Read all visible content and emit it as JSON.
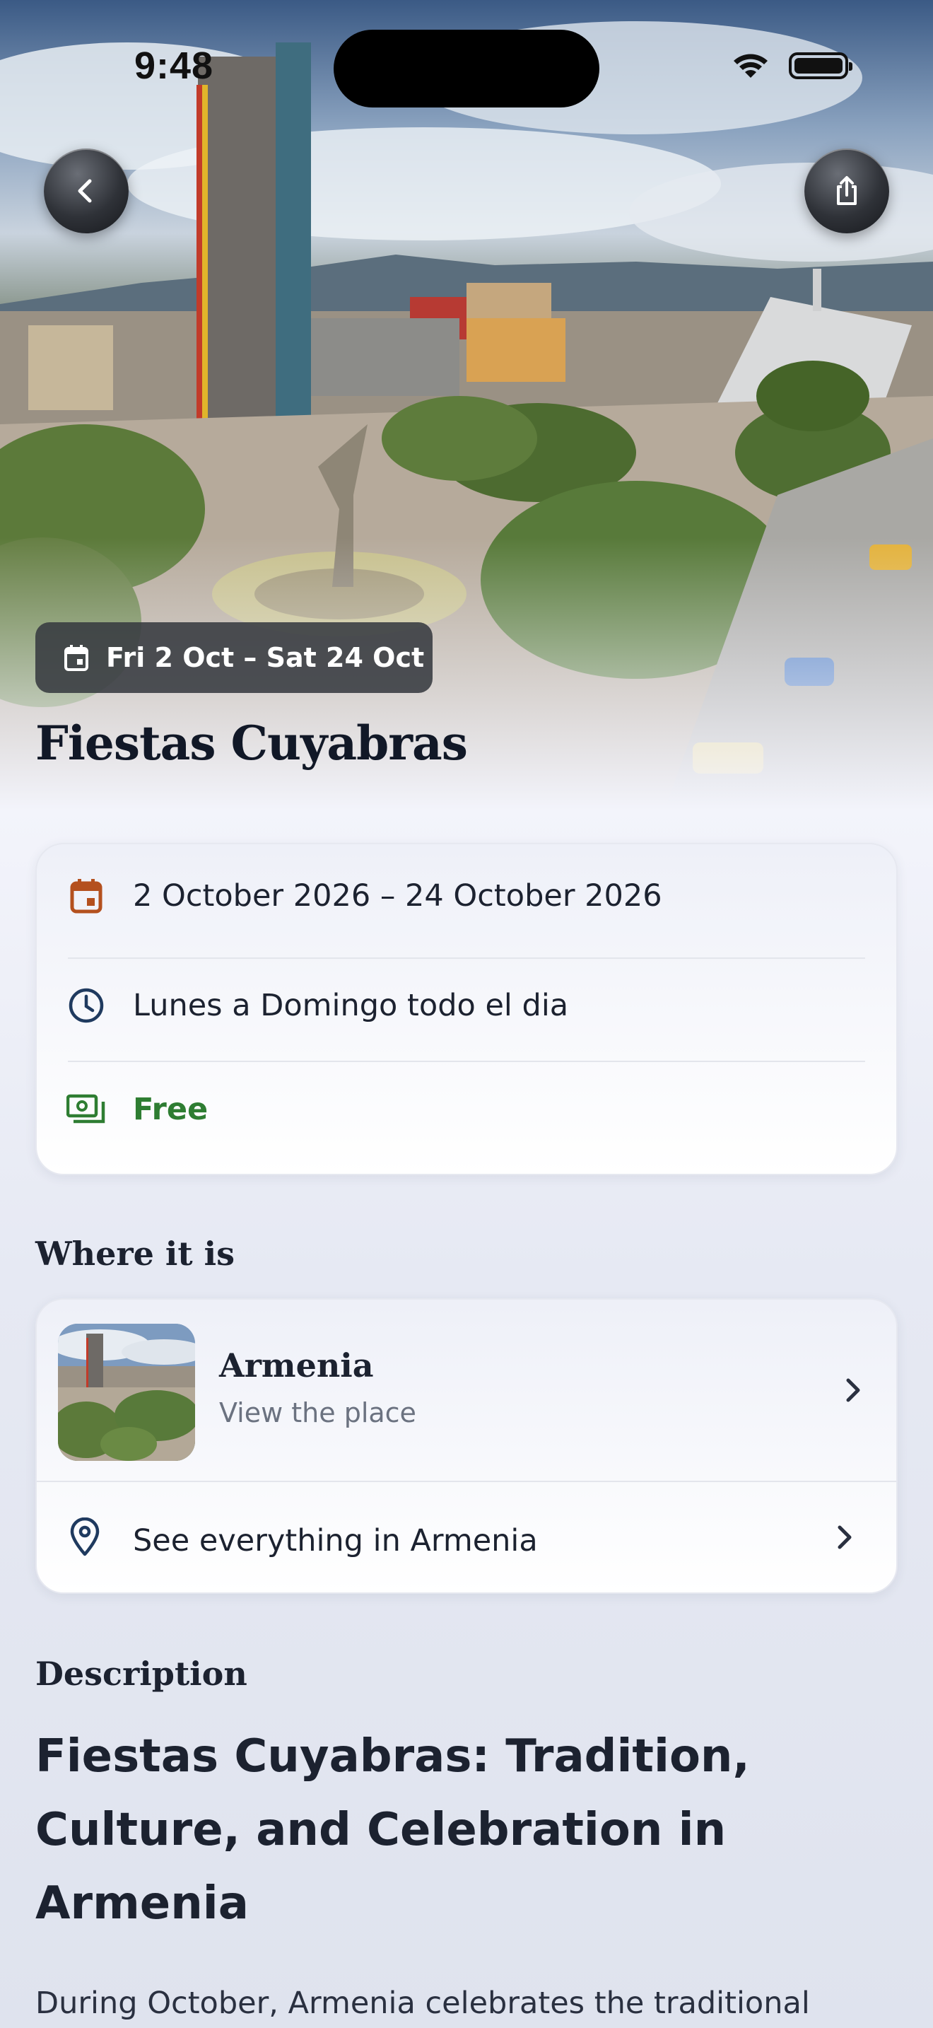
{
  "status_bar": {
    "time": "9:48"
  },
  "hero": {
    "date_pill": "Fri 2 Oct – Sat 24 Oct",
    "title": "Fiestas Cuyabras"
  },
  "info": {
    "dates": "2 October 2026 – 24 October 2026",
    "hours": "Lunes  a  Domingo todo el dia",
    "price": "Free"
  },
  "where": {
    "heading": "Where it is",
    "place_name": "Armenia",
    "place_sub": "View the place",
    "see_all": "See everything in Armenia"
  },
  "description": {
    "heading": "Description",
    "title": "Fiestas Cuyabras: Tradition, Culture, and Celebration in Armenia",
    "body": "During October, Armenia celebrates the traditional"
  },
  "colors": {
    "calendar_icon": "#b4501e",
    "clock_icon": "#1f3a5f",
    "price_green": "#2e7d32",
    "text_dark": "#1c2230"
  },
  "icons": {
    "back": "chevron-left-icon",
    "share": "share-icon",
    "calendar": "calendar-icon",
    "clock": "clock-icon",
    "money": "money-icon",
    "pin": "location-pin-icon"
  }
}
